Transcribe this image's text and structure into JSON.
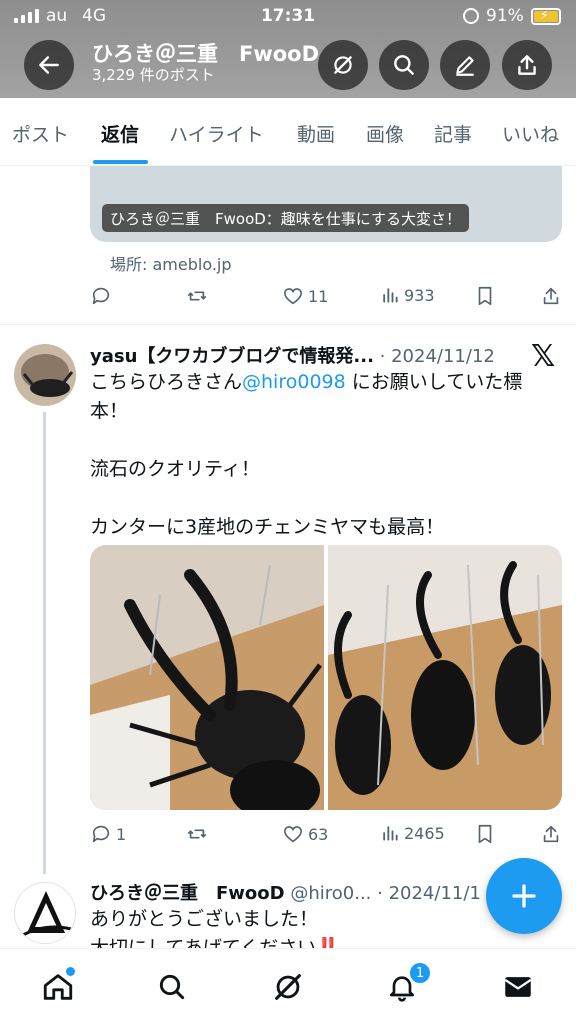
{
  "status_bar": {
    "carrier": "au",
    "network": "4G",
    "time": "17:31",
    "battery": "91%"
  },
  "header": {
    "title": "ひろき＠三重　FwooD",
    "post_count": "3,229 件のポスト"
  },
  "tabs": [
    "ポスト",
    "返信",
    "ハイライト",
    "動画",
    "画像",
    "記事",
    "いいね"
  ],
  "active_tab": "返信",
  "prev_tweet": {
    "card_title": "ひろき＠三重　FwooD：趣味を仕事にする大変さ！",
    "source_label": "場所: ameblo.jp",
    "retweets": "",
    "likes": "11",
    "views": "933"
  },
  "tweet": {
    "author": "yasu【クワカブブログで情報発...",
    "date": "· 2024/11/12",
    "text_line1_prefix": "こちらひろきさん",
    "mention": "@hiro0098",
    "text_line1_suffix": " にお願いしていた標",
    "text_line2": "本！",
    "text_line3": "",
    "text_line4": "流石のクオリティ！",
    "text_line5": "",
    "text_line6": "カンターに3産地のチェンミヤマも最高！",
    "replies": "1",
    "likes": "63",
    "views": "2465"
  },
  "reply_tweet": {
    "author": "ひろき＠三重　FwooD",
    "handle": "@hiro0...",
    "date": "· 2024/11/1",
    "line1": "ありがとうございました！",
    "line2": "大切にしてあげてください‼️"
  },
  "bottom_nav": {
    "notifications_badge": "1"
  },
  "colors": {
    "accent": "#1d9bf0",
    "text": "#0f1419",
    "muted": "#536471"
  }
}
